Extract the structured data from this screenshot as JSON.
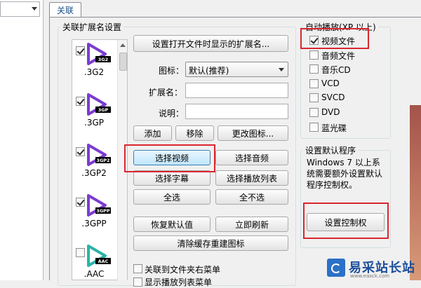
{
  "tab": {
    "label": "关联"
  },
  "left_group": {
    "title": "关联扩展名设置",
    "formats": [
      {
        "badge": "3G2",
        "label": ".3G2",
        "checked": true,
        "color": "#7b3ccf"
      },
      {
        "badge": "3GP",
        "label": ".3GP",
        "checked": true,
        "color": "#7b3ccf"
      },
      {
        "badge": "3GP2",
        "label": ".3GP2",
        "checked": true,
        "color": "#7b3ccf"
      },
      {
        "badge": "3GPP",
        "label": ".3GPP",
        "checked": true,
        "color": "#7b3ccf"
      },
      {
        "badge": "AAC",
        "label": ".AAC",
        "checked": false,
        "color": "#2bb3a6"
      }
    ]
  },
  "main": {
    "set_ext_button": "设置打开文件时显示的扩展名...",
    "icon_label": "图标：",
    "icon_select_value": "默认(推荐)",
    "ext_label": "扩展名：",
    "ext_value": "",
    "desc_label": "说明：",
    "desc_value": "",
    "add_button": "添加",
    "remove_button": "移除",
    "change_icon_button": "更改图标...",
    "select_video_button": "选择视频",
    "select_audio_button": "选择音频",
    "select_subtitle_button": "选择字幕",
    "select_playlist_button": "选择播放列表",
    "select_all_button": "全选",
    "select_none_button": "全不选",
    "restore_default_button": "恢复默认值",
    "refresh_button": "立即刷新",
    "clear_cache_button": "清除缓存重建图标",
    "folder_menu_label": "关联到文件夹右菜单",
    "playlist_menu_label": "显示播放列表菜单"
  },
  "autoplay": {
    "title": "自动播放(XP 以上)",
    "items": [
      {
        "label": "视频文件",
        "checked": true
      },
      {
        "label": "音频文件",
        "checked": false
      },
      {
        "label": "音乐CD",
        "checked": false
      },
      {
        "label": "VCD",
        "checked": false
      },
      {
        "label": "SVCD",
        "checked": false
      },
      {
        "label": "DVD",
        "checked": false
      },
      {
        "label": "蓝光碟",
        "checked": false
      }
    ]
  },
  "default_program": {
    "title": "设置默认程序",
    "description": "Windows 7 以上系统需要额外设置默认程序控制权。",
    "button": "设置控制权"
  },
  "watermark": {
    "text": "易采站长站",
    "subtext": "www.easck.com"
  },
  "colors": {
    "highlight_border": "#d9262f",
    "accent": "#3c7fb1"
  }
}
